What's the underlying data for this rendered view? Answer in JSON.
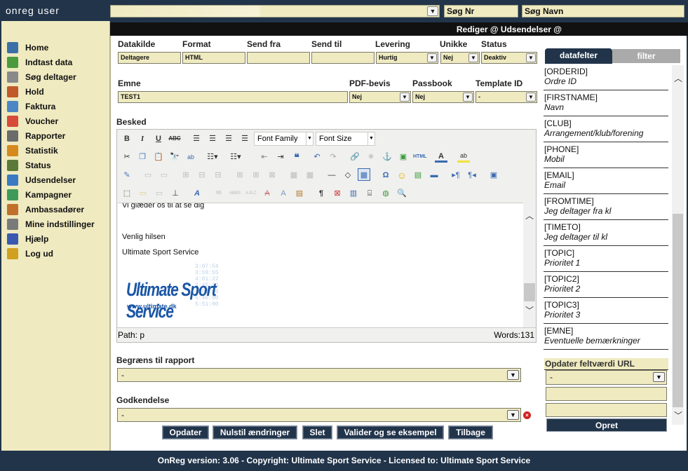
{
  "app": {
    "brand": "onreg user"
  },
  "top": {
    "select_value": "",
    "search_nr_label": "Søg Nr",
    "search_name_label": "Søg Navn"
  },
  "nav": [
    {
      "label": "Home",
      "icon": "home-icon",
      "color": "#3c6fa8"
    },
    {
      "label": "Indtast data",
      "icon": "add-data-icon",
      "color": "#4b9a3e"
    },
    {
      "label": "Søg deltager",
      "icon": "search-participant-icon",
      "color": "#8a8a8a"
    },
    {
      "label": "Hold",
      "icon": "team-icon",
      "color": "#c05a2a"
    },
    {
      "label": "Faktura",
      "icon": "invoice-icon",
      "color": "#4d86c4"
    },
    {
      "label": "Voucher",
      "icon": "voucher-gift-icon",
      "color": "#d64b3a"
    },
    {
      "label": "Rapporter",
      "icon": "report-icon",
      "color": "#6b6b6b"
    },
    {
      "label": "Statistik",
      "icon": "statistics-icon",
      "color": "#d68a1e"
    },
    {
      "label": "Status",
      "icon": "status-icon",
      "color": "#5a7a3a"
    },
    {
      "label": "Udsendelser",
      "icon": "mailing-icon",
      "color": "#3a7ac2"
    },
    {
      "label": "Kampagner",
      "icon": "campaign-globe-icon",
      "color": "#3f9a5a"
    },
    {
      "label": "Ambassadører",
      "icon": "ambassador-icon",
      "color": "#c0702a"
    },
    {
      "label": "Mine indstillinger",
      "icon": "settings-gear-icon",
      "color": "#7a7a7a"
    },
    {
      "label": "Hjælp",
      "icon": "help-icon",
      "color": "#3a5ab0"
    },
    {
      "label": "Log ud",
      "icon": "logout-lock-icon",
      "color": "#d1a020"
    }
  ],
  "header": {
    "title": "Rediger @ Udsendelser @"
  },
  "form": {
    "labels": {
      "datakilde": "Datakilde",
      "format": "Format",
      "send_fra": "Send fra",
      "send_til": "Send til",
      "levering": "Levering",
      "unikke": "Unikke",
      "status": "Status",
      "emne": "Emne",
      "pdf": "PDF-bevis",
      "passbook": "Passbook",
      "template": "Template ID",
      "besked": "Besked",
      "begraens": "Begræns til rapport",
      "godkendelse": "Godkendelse"
    },
    "values": {
      "datakilde": "Deltagere",
      "format": "HTML",
      "send_fra": "",
      "send_til": "",
      "levering": "Hurtig",
      "unikke": "Nej",
      "status": "Deaktiv",
      "emne": "TEST1",
      "pdf": "Nej",
      "passbook": "Nej",
      "template": "-",
      "begraens": "-",
      "godkendelse": "-"
    }
  },
  "editor": {
    "font_family": "Font Family",
    "font_size": "Font Size",
    "lines": [
      "Vi glæder os til at se dig",
      "Venlig hilsen",
      "Ultimate Sport Service"
    ],
    "logo_text": "Ultimate Sport Service",
    "logo_url": "www.ultimate.dk",
    "logo_times": [
      "3:07:54",
      "3:59:55",
      "4:01:22",
      "3:45:33",
      "4:03:50",
      "5:40:00",
      "5:51:00"
    ],
    "path": "Path: p",
    "words": "Words:131",
    "toolbar_html": "HTML"
  },
  "buttons": {
    "opdater": "Opdater",
    "nulstil": "Nulstil ændringer",
    "slet": "Slet",
    "valider": "Valider og se eksempel",
    "tilbage": "Tilbage"
  },
  "right": {
    "tab_active": "datafelter",
    "tab_inactive": "filter",
    "fields": [
      {
        "tag": "[ORDERID]",
        "desc": "Ordre ID"
      },
      {
        "tag": "[FIRSTNAME]",
        "desc": "Navn"
      },
      {
        "tag": "[CLUB]",
        "desc": "Arrangement/klub/forening"
      },
      {
        "tag": "[PHONE]",
        "desc": "Mobil"
      },
      {
        "tag": "[EMAIL]",
        "desc": "Email"
      },
      {
        "tag": "[FROMTIME]",
        "desc": "Jeg deltager fra kl"
      },
      {
        "tag": "[TIMETO]",
        "desc": "Jeg deltager til kl"
      },
      {
        "tag": "[TOPIC]",
        "desc": "Prioritet 1"
      },
      {
        "tag": "[TOPIC2]",
        "desc": "Prioritet 2"
      },
      {
        "tag": "[TOPIC3]",
        "desc": "Prioritet 3"
      },
      {
        "tag": "[EMNE]",
        "desc": "Eventuelle bemærkninger"
      }
    ],
    "update_label": "Opdater feltværdi URL",
    "update_select": "-",
    "opret": "Opret"
  },
  "footer": {
    "text": "OnReg version: 3.06 - Copyright: Ultimate Sport Service - Licensed to: Ultimate Sport Service"
  }
}
